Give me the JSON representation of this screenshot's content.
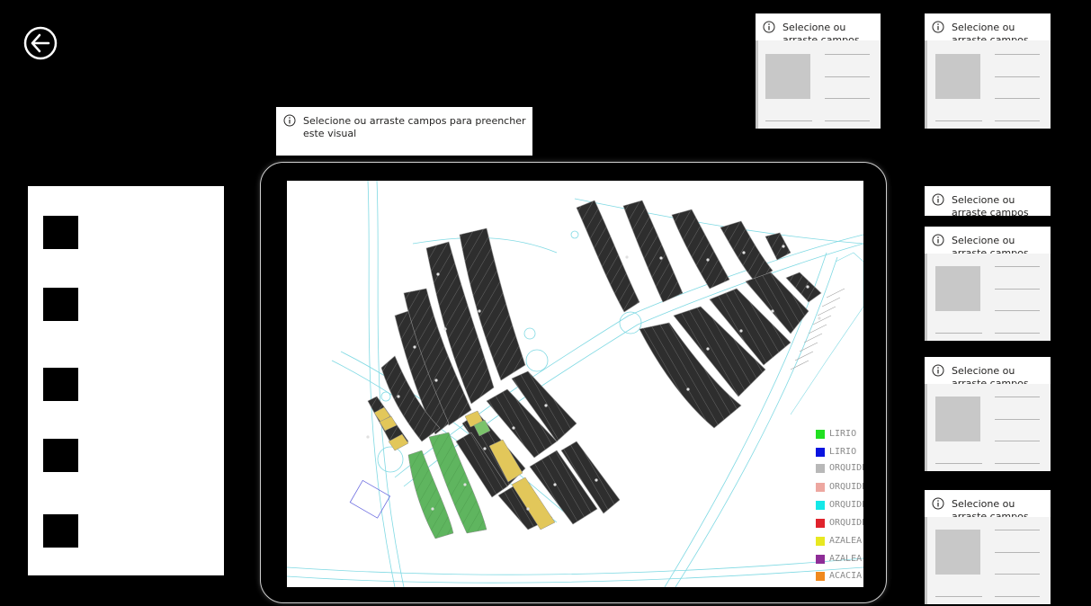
{
  "nav": {
    "back_icon": "arrow-left-circle-icon"
  },
  "info_message": {
    "long": "Selecione ou arraste campos para preencher este visual",
    "short": "Selecione ou arraste campos para preencher este visual",
    "icon": "info-icon"
  },
  "map": {
    "colors": {
      "lot": "#2e2e2e",
      "lot_border": "#8c8c8c",
      "road": "#7fd9e3",
      "green": "#5fb55f",
      "yellow": "#e2c75a",
      "green_alt": "#7bc36b"
    },
    "legend": [
      {
        "label": "LIRIO",
        "color": "#21e021"
      },
      {
        "label": "LIRIO",
        "color": "#0a14e0"
      },
      {
        "label": "ORQUIDEA",
        "color": "#b8b8b8"
      },
      {
        "label": "ORQUIDEA",
        "color": "#eda7a0"
      },
      {
        "label": "ORQUIDEA",
        "color": "#14e8e8"
      },
      {
        "label": "ORQUIDEA",
        "color": "#e0232c"
      },
      {
        "label": "AZALEA",
        "color": "#e8e821"
      },
      {
        "label": "AZALEA",
        "color": "#8e2d97"
      },
      {
        "label": "ACACIA",
        "color": "#f0891e"
      }
    ]
  }
}
